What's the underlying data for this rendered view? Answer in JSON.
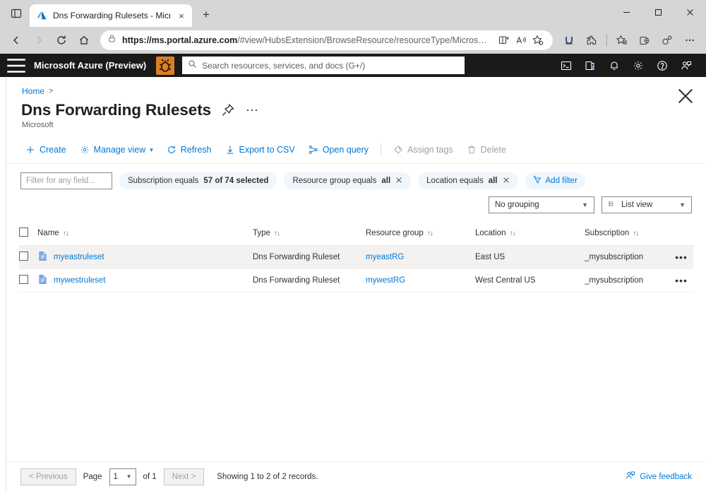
{
  "browser": {
    "tab": {
      "title": "Dns Forwarding Rulesets - Micro",
      "favicon": "azure-logo-icon",
      "close_label": "×"
    },
    "new_tab_label": "+",
    "window_controls": {
      "minimize": "minimize-icon",
      "maximize": "maximize-icon",
      "close": "close-icon"
    },
    "nav": {
      "back": "back-arrow-icon",
      "forward": "forward-arrow-icon",
      "refresh": "refresh-icon",
      "home": "home-icon"
    },
    "omnibox": {
      "lock": "lock-icon",
      "url_prefix": "https://ms.portal.azure.com",
      "url_path": "/#view/HubsExtension/BrowseResource/resourceType/Microsoft.N...",
      "icons": [
        "split-screen-icon",
        "read-aloud-icon",
        "add-favorite-icon"
      ]
    },
    "toolbar_icons": [
      "u-extension-icon",
      "puzzle-extensions-icon",
      "favorites-icon",
      "collections-icon",
      "browser-essentials-icon",
      "settings-more-icon"
    ]
  },
  "azure_header": {
    "menu_icon": "hamburger-menu-icon",
    "brand": "Microsoft Azure (Preview)",
    "preview_badge_icon": "bug-preview-icon",
    "preview_badge_color": "#d98026",
    "search_placeholder": "Search resources, services, and docs (G+/)",
    "search_icon": "search-icon",
    "right_icons": [
      "cloud-shell-icon",
      "directories-subscriptions-icon",
      "notifications-icon",
      "settings-gear-icon",
      "help-icon",
      "feedback-icon"
    ]
  },
  "blade": {
    "breadcrumb": {
      "home": "Home",
      "separator": ">"
    },
    "title": "Dns Forwarding Rulesets",
    "subtitle": "Microsoft",
    "pin_icon": "pin-icon",
    "more_icon": "ellipsis-icon",
    "close_icon": "close-icon"
  },
  "command_bar": {
    "items": [
      {
        "label": "Create",
        "icon": "plus-icon",
        "disabled": false
      },
      {
        "label": "Manage view",
        "icon": "gear-icon",
        "disabled": false,
        "chevron": true
      },
      {
        "label": "Refresh",
        "icon": "refresh-icon",
        "disabled": false
      },
      {
        "label": "Export to CSV",
        "icon": "download-icon",
        "disabled": false
      },
      {
        "label": "Open query",
        "icon": "query-icon",
        "disabled": false
      },
      {
        "label": "Assign tags",
        "icon": "tag-icon",
        "disabled": true
      },
      {
        "label": "Delete",
        "icon": "trash-icon",
        "disabled": true
      }
    ]
  },
  "filters": {
    "input_placeholder": "Filter for any field...",
    "pills": [
      {
        "prefix": "Subscription equals",
        "value": "57 of 74 selected",
        "removable": false
      },
      {
        "prefix": "Resource group equals",
        "value": "all",
        "removable": true
      },
      {
        "prefix": "Location equals",
        "value": "all",
        "removable": true
      }
    ],
    "add_filter_label": "Add filter",
    "add_filter_icon": "add-filter-icon"
  },
  "view_controls": {
    "grouping": "No grouping",
    "view": "List view",
    "view_icon": "list-view-icon",
    "chevron": "⌄"
  },
  "table": {
    "columns": [
      {
        "label": "Name",
        "sort": "↑↓"
      },
      {
        "label": "Type",
        "sort": "↑↓"
      },
      {
        "label": "Resource group",
        "sort": "↑↓"
      },
      {
        "label": "Location",
        "sort": "↑↓"
      },
      {
        "label": "Subscription",
        "sort": "↑↓"
      }
    ],
    "rows": [
      {
        "name": "myeastruleset",
        "type": "Dns Forwarding Ruleset",
        "resource_group": "myeastRG",
        "location": "East US",
        "subscription": "_mysubscription",
        "icon": "dns-ruleset-icon",
        "menu": "•••"
      },
      {
        "name": "mywestruleset",
        "type": "Dns Forwarding Ruleset",
        "resource_group": "mywestRG",
        "location": "West Central US",
        "subscription": "_mysubscription",
        "icon": "dns-ruleset-icon",
        "menu": "•••"
      }
    ]
  },
  "footer": {
    "previous": "< Previous",
    "page_label": "Page",
    "page_value": "1",
    "of_label": "of 1",
    "next": "Next >",
    "records": "Showing 1 to 2 of 2 records.",
    "give_feedback": "Give feedback",
    "feedback_icon": "feedback-icon"
  },
  "colors": {
    "azure_blue": "#0078d4",
    "header_dark": "#1b1a19",
    "pill_bg": "#eff6fc",
    "row_alt": "#f3f2f1",
    "preview_orange": "#d98026"
  }
}
